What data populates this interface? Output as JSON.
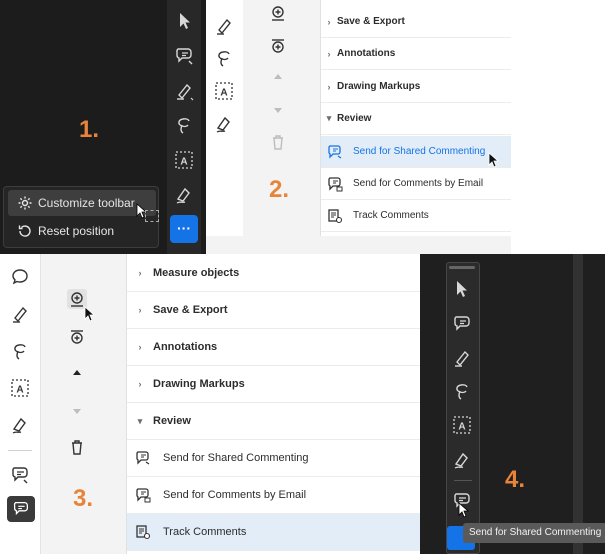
{
  "panel1": {
    "step": "1.",
    "menu": {
      "customize_label": "Customize toolbar",
      "reset_label": "Reset position"
    },
    "more_label": "···"
  },
  "panel2": {
    "step": "2.",
    "rows": [
      {
        "label": "Save & Export"
      },
      {
        "label": "Annotations"
      },
      {
        "label": "Drawing Markups"
      },
      {
        "label": "Review"
      }
    ],
    "review_items": [
      {
        "label": "Send for Shared Commenting"
      },
      {
        "label": "Send for Comments by Email"
      },
      {
        "label": "Track Comments"
      }
    ]
  },
  "panel3": {
    "step": "3.",
    "rows": [
      {
        "label": "Measure objects"
      },
      {
        "label": "Save & Export"
      },
      {
        "label": "Annotations"
      },
      {
        "label": "Drawing Markups"
      },
      {
        "label": "Review"
      }
    ],
    "review_items": [
      {
        "label": "Send for Shared Commenting"
      },
      {
        "label": "Send for Comments by Email"
      },
      {
        "label": "Track Comments"
      }
    ]
  },
  "panel4": {
    "step": "4.",
    "tooltip": "Send for Shared Commenting"
  },
  "colors": {
    "accent": "#1473e6",
    "step_orange": "#e8833a",
    "dark_bg": "#1c1c1c"
  }
}
